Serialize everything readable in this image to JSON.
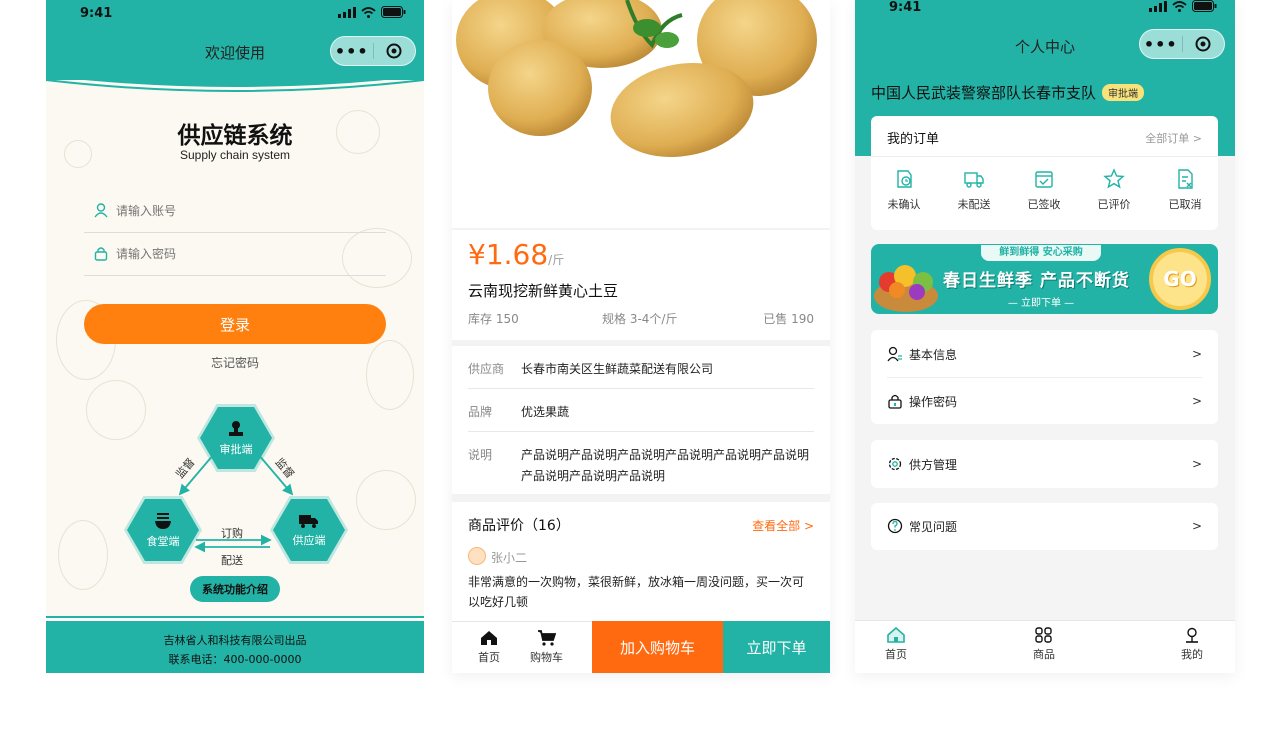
{
  "status": {
    "time": "9:41"
  },
  "login": {
    "nav_title": "欢迎使用",
    "app_title": "供应链系统",
    "app_subtitle": "Supply chain system",
    "account_placeholder": "请输入账号",
    "password_placeholder": "请输入密码",
    "login_button": "登录",
    "forgot_link": "忘记密码",
    "diagram": {
      "top_node": "审批端",
      "left_node": "食堂端",
      "right_node": "供应端",
      "left_edge": "监督",
      "right_edge": "监督",
      "top_arrow": "订购",
      "bottom_arrow": "配送",
      "intro_button": "系统功能介绍"
    },
    "footer_company": "吉林省人和科技有限公司出品",
    "footer_phone": "联系电话：400-000-0000"
  },
  "product": {
    "price": "¥1.68",
    "unit": "/斤",
    "name": "云南现挖新鲜黄心土豆",
    "stock": "库存  150",
    "spec": "规格 3-4个/斤",
    "sold": "已售  190",
    "details": [
      {
        "label": "供应商",
        "value": "长春市南关区生鲜蔬菜配送有限公司"
      },
      {
        "label": "品牌",
        "value": "优选果蔬"
      },
      {
        "label": "说明",
        "value": "产品说明产品说明产品说明产品说明产品说明产品说明产品说明产品说明产品说明"
      }
    ],
    "reviews_title": "商品评价（16）",
    "reviews_all": "查看全部 >",
    "reviewer": "张小二",
    "review_text": "非常满意的一次购物，菜很新鲜，放冰箱一周没问题，买一次可以吃好几顿",
    "tab_home": "首页",
    "tab_cart": "购物车",
    "add_cart": "加入购物车",
    "buy_now": "立即下单",
    "colors": {
      "orange": "#ff6a10",
      "teal": "#22b3a6"
    }
  },
  "profile": {
    "nav_title": "个人中心",
    "org_name": "中国人民武装警察部队长春市支队",
    "role_badge": "审批端",
    "orders_title": "我的订单",
    "orders_all": "全部订单 >",
    "order_states": [
      "未确认",
      "未配送",
      "已签收",
      "已评价",
      "已取消"
    ],
    "banner_tag": "鲜到鲜得 安心采购",
    "banner_main": "春日生鲜季 产品不断货",
    "banner_cta": "— 立即下单 —",
    "banner_go": "GO",
    "menu": [
      {
        "label": "基本信息",
        "chev": ">"
      },
      {
        "label": "操作密码",
        "chev": ">"
      },
      {
        "label": "供方管理",
        "chev": ">"
      },
      {
        "label": "常见问题",
        "chev": ">"
      }
    ],
    "tabs": [
      "首页",
      "商品",
      "我的"
    ]
  }
}
